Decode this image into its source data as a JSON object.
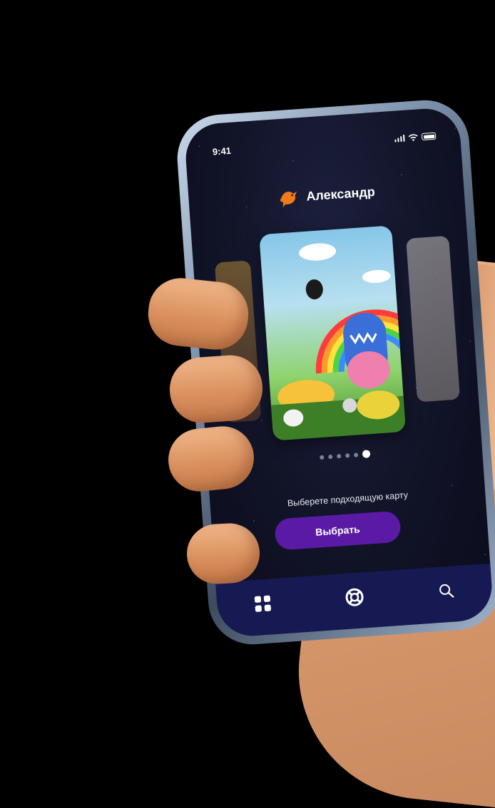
{
  "status_bar": {
    "time": "9:41"
  },
  "header": {
    "user_name": "Александр",
    "logo_icon": "bird-logo-icon"
  },
  "carousel": {
    "total_dots": 6,
    "active_dot": 6
  },
  "hint_text": "Выберете подходящую карту",
  "select_button": {
    "label": "Выбрать"
  },
  "tab_bar": {
    "items": [
      {
        "icon": "grid-icon"
      },
      {
        "icon": "lifebuoy-icon"
      },
      {
        "icon": "search-icon"
      }
    ]
  },
  "colors": {
    "accent": "#5a1aa5",
    "tab_bar": "#171a52",
    "background": "#111327"
  }
}
